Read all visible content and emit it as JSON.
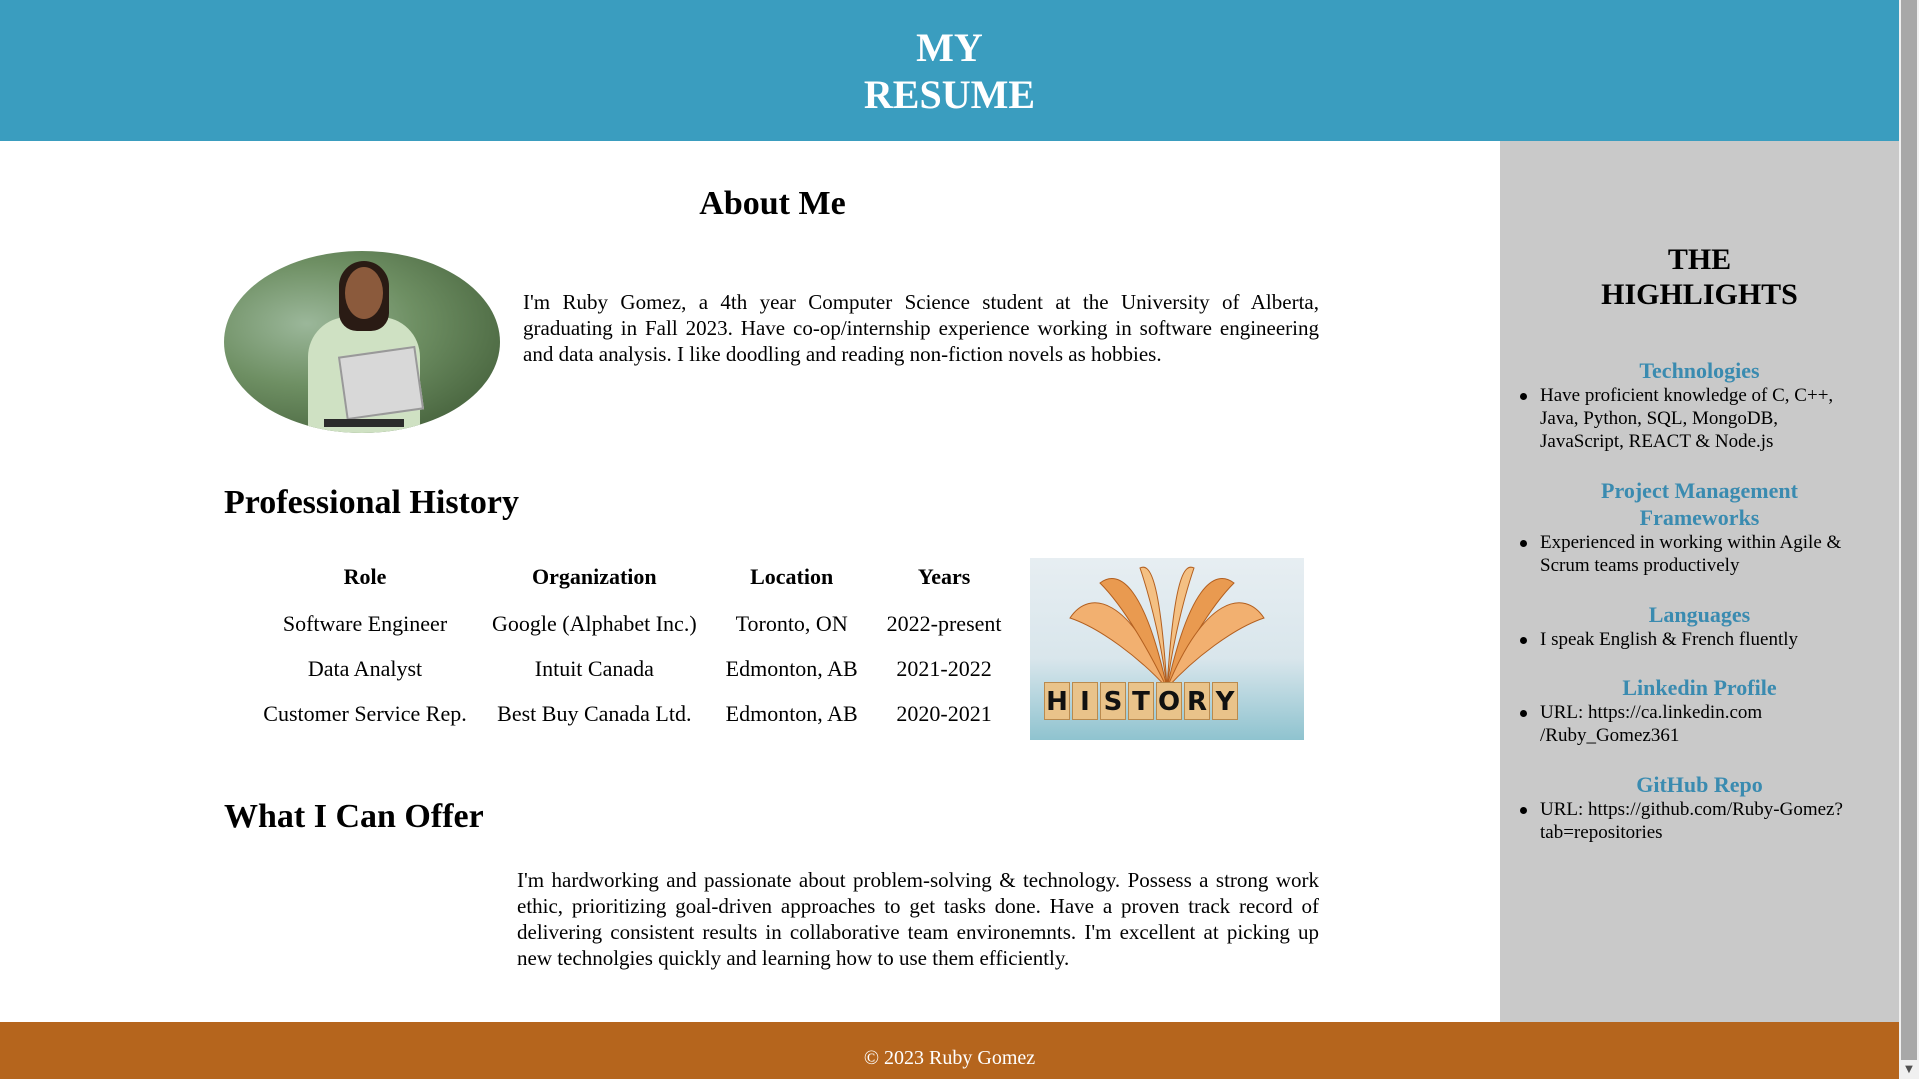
{
  "header": {
    "title_line1": "MY",
    "title_line2": "RESUME"
  },
  "about": {
    "title": "About Me",
    "text": "I'm Ruby Gomez, a 4th year Computer Science student at the University of Alberta, graduating in Fall 2023. Have co-op/internship experience working in software engineering and data analysis. I like doodling and reading non-fiction novels as hobbies."
  },
  "history": {
    "title": "Professional History",
    "columns": [
      "Role",
      "Organization",
      "Location",
      "Years"
    ],
    "rows": [
      [
        "Software Engineer",
        "Google (Alphabet Inc.)",
        "Toronto, ON",
        "2022-present"
      ],
      [
        "Data Analyst",
        "Intuit Canada",
        "Edmonton, AB",
        "2021-2022"
      ],
      [
        "Customer Service Rep.",
        "Best Buy Canada Ltd.",
        "Edmonton, AB",
        "2020-2021"
      ]
    ],
    "image_letters": [
      "H",
      "I",
      "S",
      "T",
      "O",
      "R",
      "Y"
    ]
  },
  "offer": {
    "title": "What I Can Offer",
    "text": "I'm hardworking and passionate about problem-solving & technology. Possess a strong work ethic, prioritizing goal-driven approaches to get tasks done. Have a proven track record of delivering consistent results in collaborative team environemnts. I'm excellent at picking up new technolgies quickly and learning how to use them efficiently."
  },
  "highlights": {
    "title_line1": "THE",
    "title_line2": "HIGHLIGHTS",
    "sections": [
      {
        "heading": "Technologies",
        "item": "Have proficient knowledge of C, C++, Java, Python, SQL, MongoDB, JavaScript, REACT & Node.js"
      },
      {
        "heading": "Project Management Frameworks",
        "item": "Experienced in working within Agile & Scrum teams productively"
      },
      {
        "heading": "Languages",
        "item": "I speak English & French fluently"
      },
      {
        "heading": "Linkedin Profile",
        "item": "URL: https://ca.linkedin.com /Ruby_Gomez361"
      },
      {
        "heading": "GitHub Repo",
        "item": "URL: https://github.com/Ruby-Gomez?tab=repositories"
      }
    ]
  },
  "footer": {
    "text": "© 2023 Ruby Gomez"
  },
  "colors": {
    "header": "#3a9dbf",
    "aside": "#c9c9c9",
    "footer": "#b5651d",
    "highlight_heading": "#3a8bb0"
  }
}
